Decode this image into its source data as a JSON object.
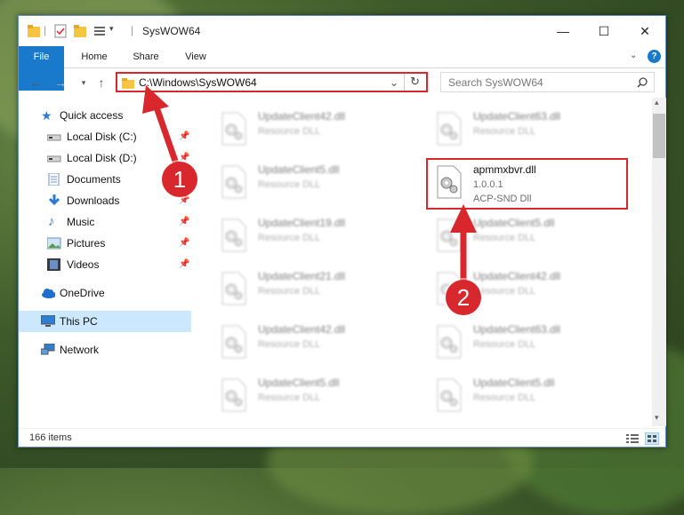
{
  "window": {
    "title": "SysWOW64",
    "minimize": "—",
    "maximize": "☐",
    "close": "✕"
  },
  "ribbon": {
    "file": "File",
    "home": "Home",
    "share": "Share",
    "view": "View",
    "help": "?"
  },
  "address": {
    "path": "C:\\Windows\\SysWOW64",
    "search_placeholder": "Search SysWOW64"
  },
  "nav": {
    "items": [
      {
        "label": "Quick access"
      },
      {
        "label": "Local Disk (C:)"
      },
      {
        "label": "Local Disk (D:)"
      },
      {
        "label": "Documents"
      },
      {
        "label": "Downloads"
      },
      {
        "label": "Music"
      },
      {
        "label": "Pictures"
      },
      {
        "label": "Videos"
      },
      {
        "label": "OneDrive"
      },
      {
        "label": "This PC"
      },
      {
        "label": "Network"
      }
    ]
  },
  "files": {
    "col1": [
      {
        "name": "UpdateClient42.dll",
        "type": "Resource DLL"
      },
      {
        "name": "UpdateClient5.dll",
        "type": "Resource DLL"
      },
      {
        "name": "UpdateClient19.dll",
        "type": "Resource DLL"
      },
      {
        "name": "UpdateClient21.dll",
        "type": "Resource DLL"
      },
      {
        "name": "UpdateClient42.dll",
        "type": "Resource DLL"
      },
      {
        "name": "UpdateClient5.dll",
        "type": "Resource DLL"
      }
    ],
    "col2": [
      {
        "name": "UpdateClient63.dll",
        "type": "Resource DLL"
      },
      {
        "name": "UpdateClient5.dll",
        "type": "Resource DLL"
      },
      {
        "name": "UpdateClient42.dll",
        "type": "Resource DLL"
      },
      {
        "name": "UpdateClient63.dll",
        "type": "Resource DLL"
      },
      {
        "name": "UpdateClient5.dll",
        "type": "Resource DLL"
      }
    ],
    "highlighted": {
      "name": "apmmxbvr.dll",
      "version": "1.0.0.1",
      "description": "ACP-SND Dll"
    }
  },
  "status": {
    "count": "166 items"
  },
  "annotations": {
    "step1": "1",
    "step2": "2",
    "color": "#d9272e"
  }
}
